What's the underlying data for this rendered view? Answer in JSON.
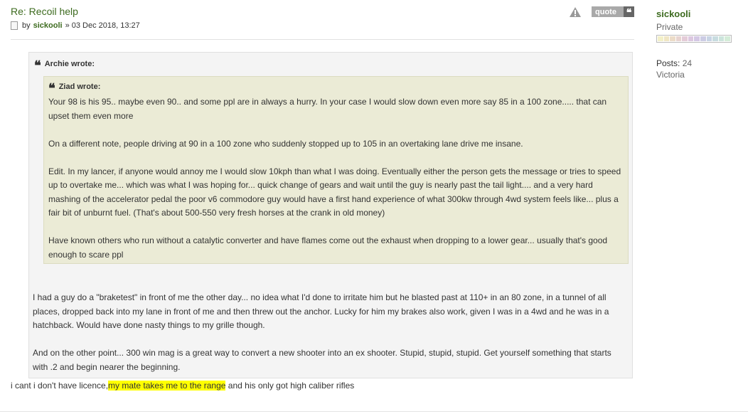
{
  "post": {
    "title": "Re: Recoil help",
    "meta_by": "by",
    "author": "sickooli",
    "meta_date": "» 03 Dec 2018, 13:27",
    "quote_label": "quote",
    "quote_glyph": "❝"
  },
  "outer_quote": {
    "cite": "Archie wrote:",
    "paragraphs": [
      "I had a guy do a \"braketest\" in front of me the other day... no idea what I'd done to irritate him but he blasted past at 110+ in an 80 zone, in a tunnel of all places, dropped back into my lane in front of me and then threw out the anchor. Lucky for him my brakes also work, given I was in a 4wd and he was in a hatchback. Would have done nasty things to my grille though.",
      "And on the other point... 300 win mag is a great way to convert a new shooter into an ex shooter. Stupid, stupid, stupid. Get yourself something that starts with .2 and begin nearer the beginning."
    ]
  },
  "inner_quote": {
    "cite": "Ziad wrote:",
    "paragraphs": [
      "Your 98 is his 95.. maybe even 90.. and some ppl are in always a hurry. In your case I would slow down even more say 85 in a 100 zone..... that can upset them even more",
      "On a different note, people driving at 90 in a 100 zone who suddenly stopped up to 105 in an overtaking lane drive me insane.",
      "Edit. In my lancer, if anyone would annoy me I would slow 10kph than what I was doing. Eventually either the person gets the message or tries to speed up to overtake me... which was what I was hoping for... quick change of gears and wait until the guy is nearly past the tail light.... and a very hard mashing of the accelerator pedal the poor v6 commodore guy would have a first hand experience of what 300kw through 4wd system feels like... plus a fair bit of unburnt fuel. (That's about 500-550 very fresh horses at the crank in old money)",
      "Have known others who run without a catalytic converter and have flames come out the exhaust when dropping to a lower gear... usually that's good enough to scare ppl"
    ]
  },
  "reply": {
    "before": "i cant i don't have licence,",
    "highlight": "my mate takes me to the range",
    "after": " and his only got high caliber rifles"
  },
  "profile": {
    "username": "sickooli",
    "rank": "Private",
    "posts_label": "Posts:",
    "posts_value": "24",
    "location": "Victoria",
    "rank_colors": [
      "#f3f0c8",
      "#f0e6c4",
      "#ecdcc8",
      "#e8d4d0",
      "#e4ccd8",
      "#dcc8e0",
      "#d4c8e4",
      "#cccce4",
      "#c8d4e4",
      "#c8dce0",
      "#cce4dc",
      "#d4ecd8"
    ]
  }
}
